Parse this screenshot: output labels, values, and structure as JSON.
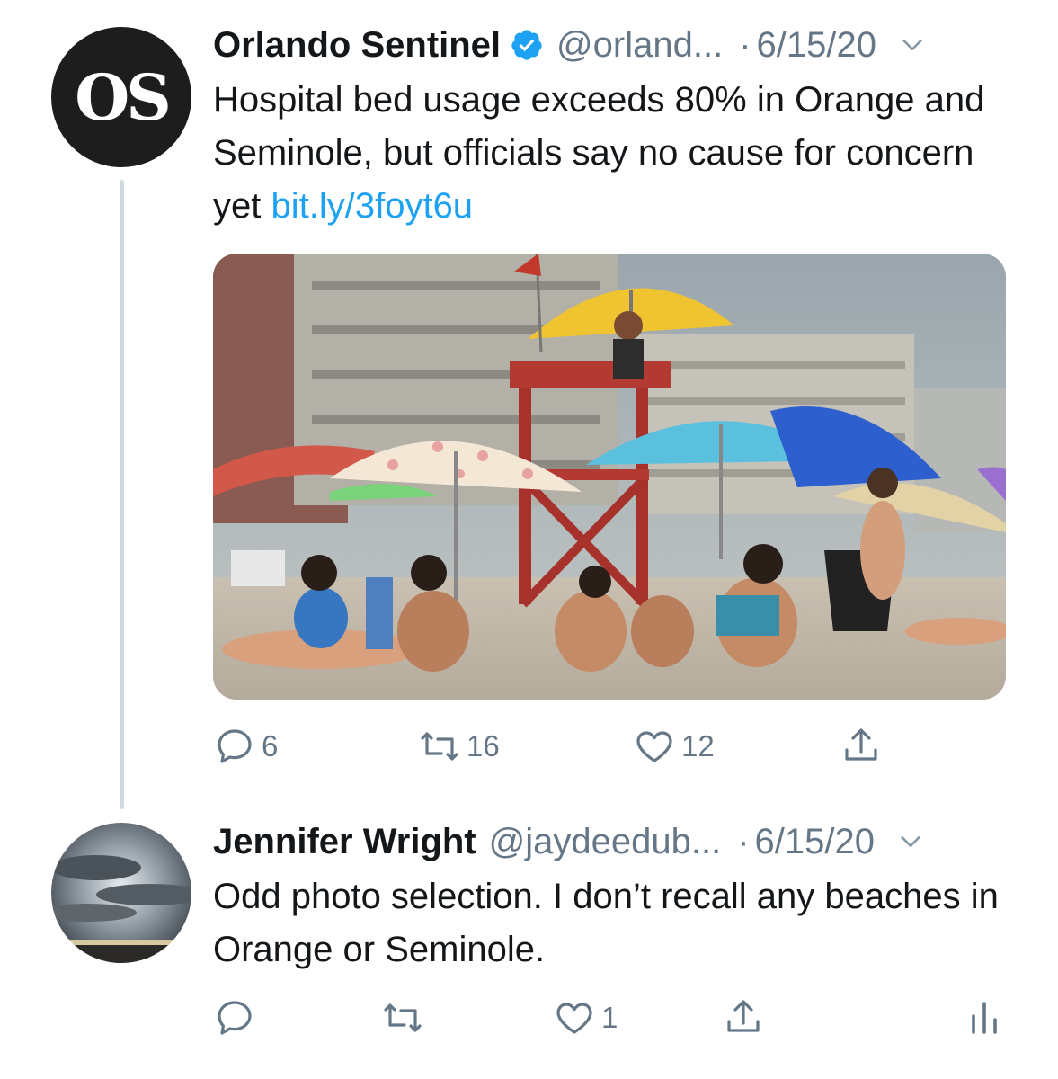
{
  "tweets": [
    {
      "author_name": "Orlando Sentinel",
      "verified": true,
      "handle": "@orland...",
      "separator": "·",
      "date": "6/15/20",
      "avatar_text": "OS",
      "text": "Hospital bed usage exceeds 80% in Orange and Seminole, but officials say no cause for concern yet ",
      "link": "bit.ly/3foyt6u",
      "media": {
        "icon": "beach-photo-image"
      },
      "stats": {
        "replies": "6",
        "retweets": "16",
        "likes": "12"
      }
    },
    {
      "author_name": "Jennifer Wright",
      "verified": false,
      "handle": "@jaydeedub...",
      "separator": "·",
      "date": "6/15/20",
      "text": "Odd photo selection. I don’t recall any beaches in Orange or Seminole.",
      "stats": {
        "replies": "",
        "retweets": "",
        "likes": "1"
      }
    }
  ],
  "colors": {
    "link": "#1da1f2",
    "secondary_text": "#657786",
    "verified": "#1da1f2",
    "thread_line": "#cfd9de"
  },
  "icons": {
    "reply": "reply-icon",
    "retweet": "retweet-icon",
    "like": "heart-icon",
    "share": "share-icon",
    "analytics": "analytics-icon",
    "more": "chevron-down-icon"
  }
}
